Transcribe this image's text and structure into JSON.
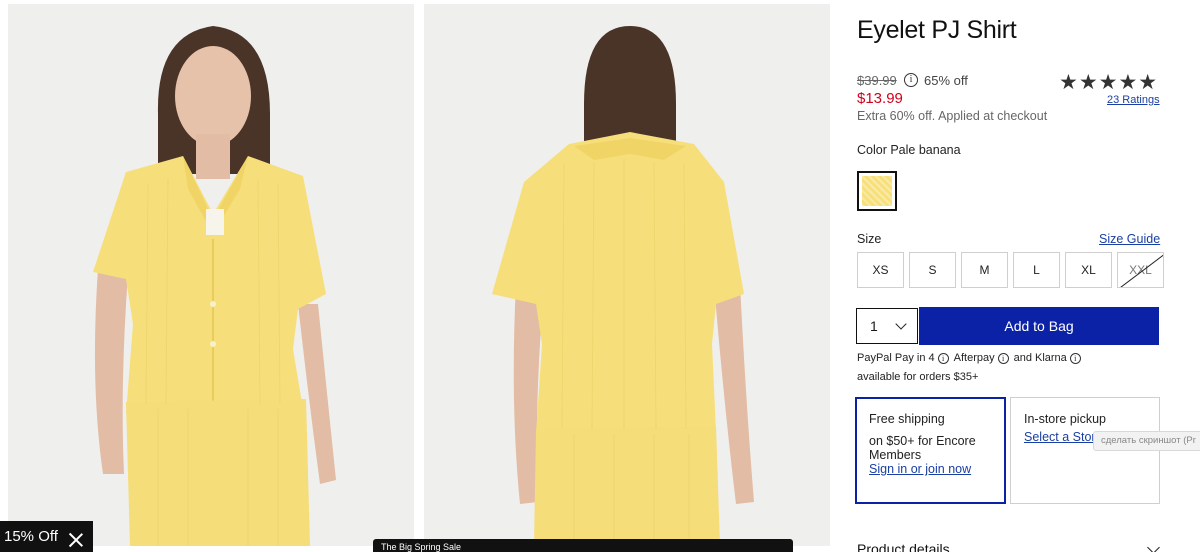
{
  "product": {
    "title": "Eyelet PJ Shirt",
    "old_price": "$39.99",
    "discount": "65% off",
    "price": "$13.99",
    "extra_offer": "Extra 60% off. Applied at checkout",
    "rating_stars": "★★★★★",
    "ratings_link": "23 Ratings",
    "info_icon": "i"
  },
  "color": {
    "label": "Color Pale banana",
    "swatch_hex": "#f7df7a"
  },
  "size": {
    "label": "Size",
    "guide_link": "Size Guide",
    "options": [
      "XS",
      "S",
      "M",
      "L",
      "XL",
      "XXL"
    ],
    "unavailable": [
      "XXL"
    ]
  },
  "cart": {
    "quantity": "1",
    "add_button": "Add to Bag",
    "accent_color": "#0b22a6"
  },
  "payment": {
    "pp_text": "PayPal Pay in 4",
    "afterpay": "Afterpay",
    "and": "and",
    "klarna": "Klarna",
    "availability": "available for orders $35+"
  },
  "shipping": {
    "title": "Free shipping",
    "detail": "on $50+ for Encore Members",
    "link": "Sign in or join now"
  },
  "pickup": {
    "title": "In-store pickup",
    "link": "Select a Store"
  },
  "tooltip": "сделать скриншот (Pr",
  "details": {
    "label": "Product details"
  },
  "promo": {
    "label": "15% Off"
  },
  "sale_bar": {
    "label": "The Big Spring Sale"
  }
}
